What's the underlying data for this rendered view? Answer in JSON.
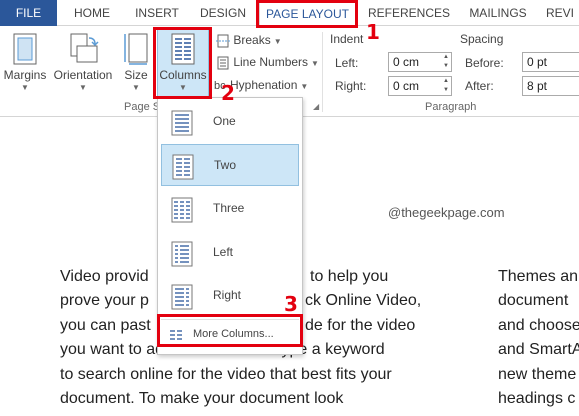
{
  "tabs": {
    "file": "FILE",
    "home": "HOME",
    "insert": "INSERT",
    "design": "DESIGN",
    "page_layout": "PAGE LAYOUT",
    "references": "REFERENCES",
    "mailings": "MAILINGS",
    "review": "REVI"
  },
  "ribbon": {
    "margins": "Margins",
    "orientation": "Orientation",
    "size": "Size",
    "columns": "Columns",
    "breaks": "Breaks",
    "line_numbers": "Line Numbers",
    "hyphenation": "Hyphenation",
    "page_setup_group": "Page S",
    "indent": {
      "title": "Indent",
      "left_label": "Left:",
      "left_value": "0 cm",
      "right_label": "Right:",
      "right_value": "0 cm"
    },
    "spacing": {
      "title": "Spacing",
      "before_label": "Before:",
      "before_value": "0 pt",
      "after_label": "After:",
      "after_value": "8 pt"
    },
    "paragraph_group": "Paragraph"
  },
  "columns_menu": {
    "items": [
      "One",
      "Two",
      "Three",
      "Left",
      "Right"
    ],
    "selected": "Two",
    "more": "More Columns..."
  },
  "annotations": [
    "1",
    "2",
    "3"
  ],
  "watermark": "@thegeekpage.com",
  "document": {
    "left_column": [
      "Video provid",
      "to help you",
      "prove your p",
      "ck Online Video,",
      "you can past",
      "de for the video",
      "you want to add. You can also type a keyword",
      "to search online for the video that best fits your",
      "document. To make your document look"
    ],
    "right_column": [
      "Themes an",
      "document",
      "and choose",
      "and SmartA",
      "new theme",
      "headings c"
    ]
  },
  "colors": {
    "file_tab_bg": "#2b579a",
    "annotation_red": "#e3000f",
    "selection_bg": "#cde6f7"
  }
}
